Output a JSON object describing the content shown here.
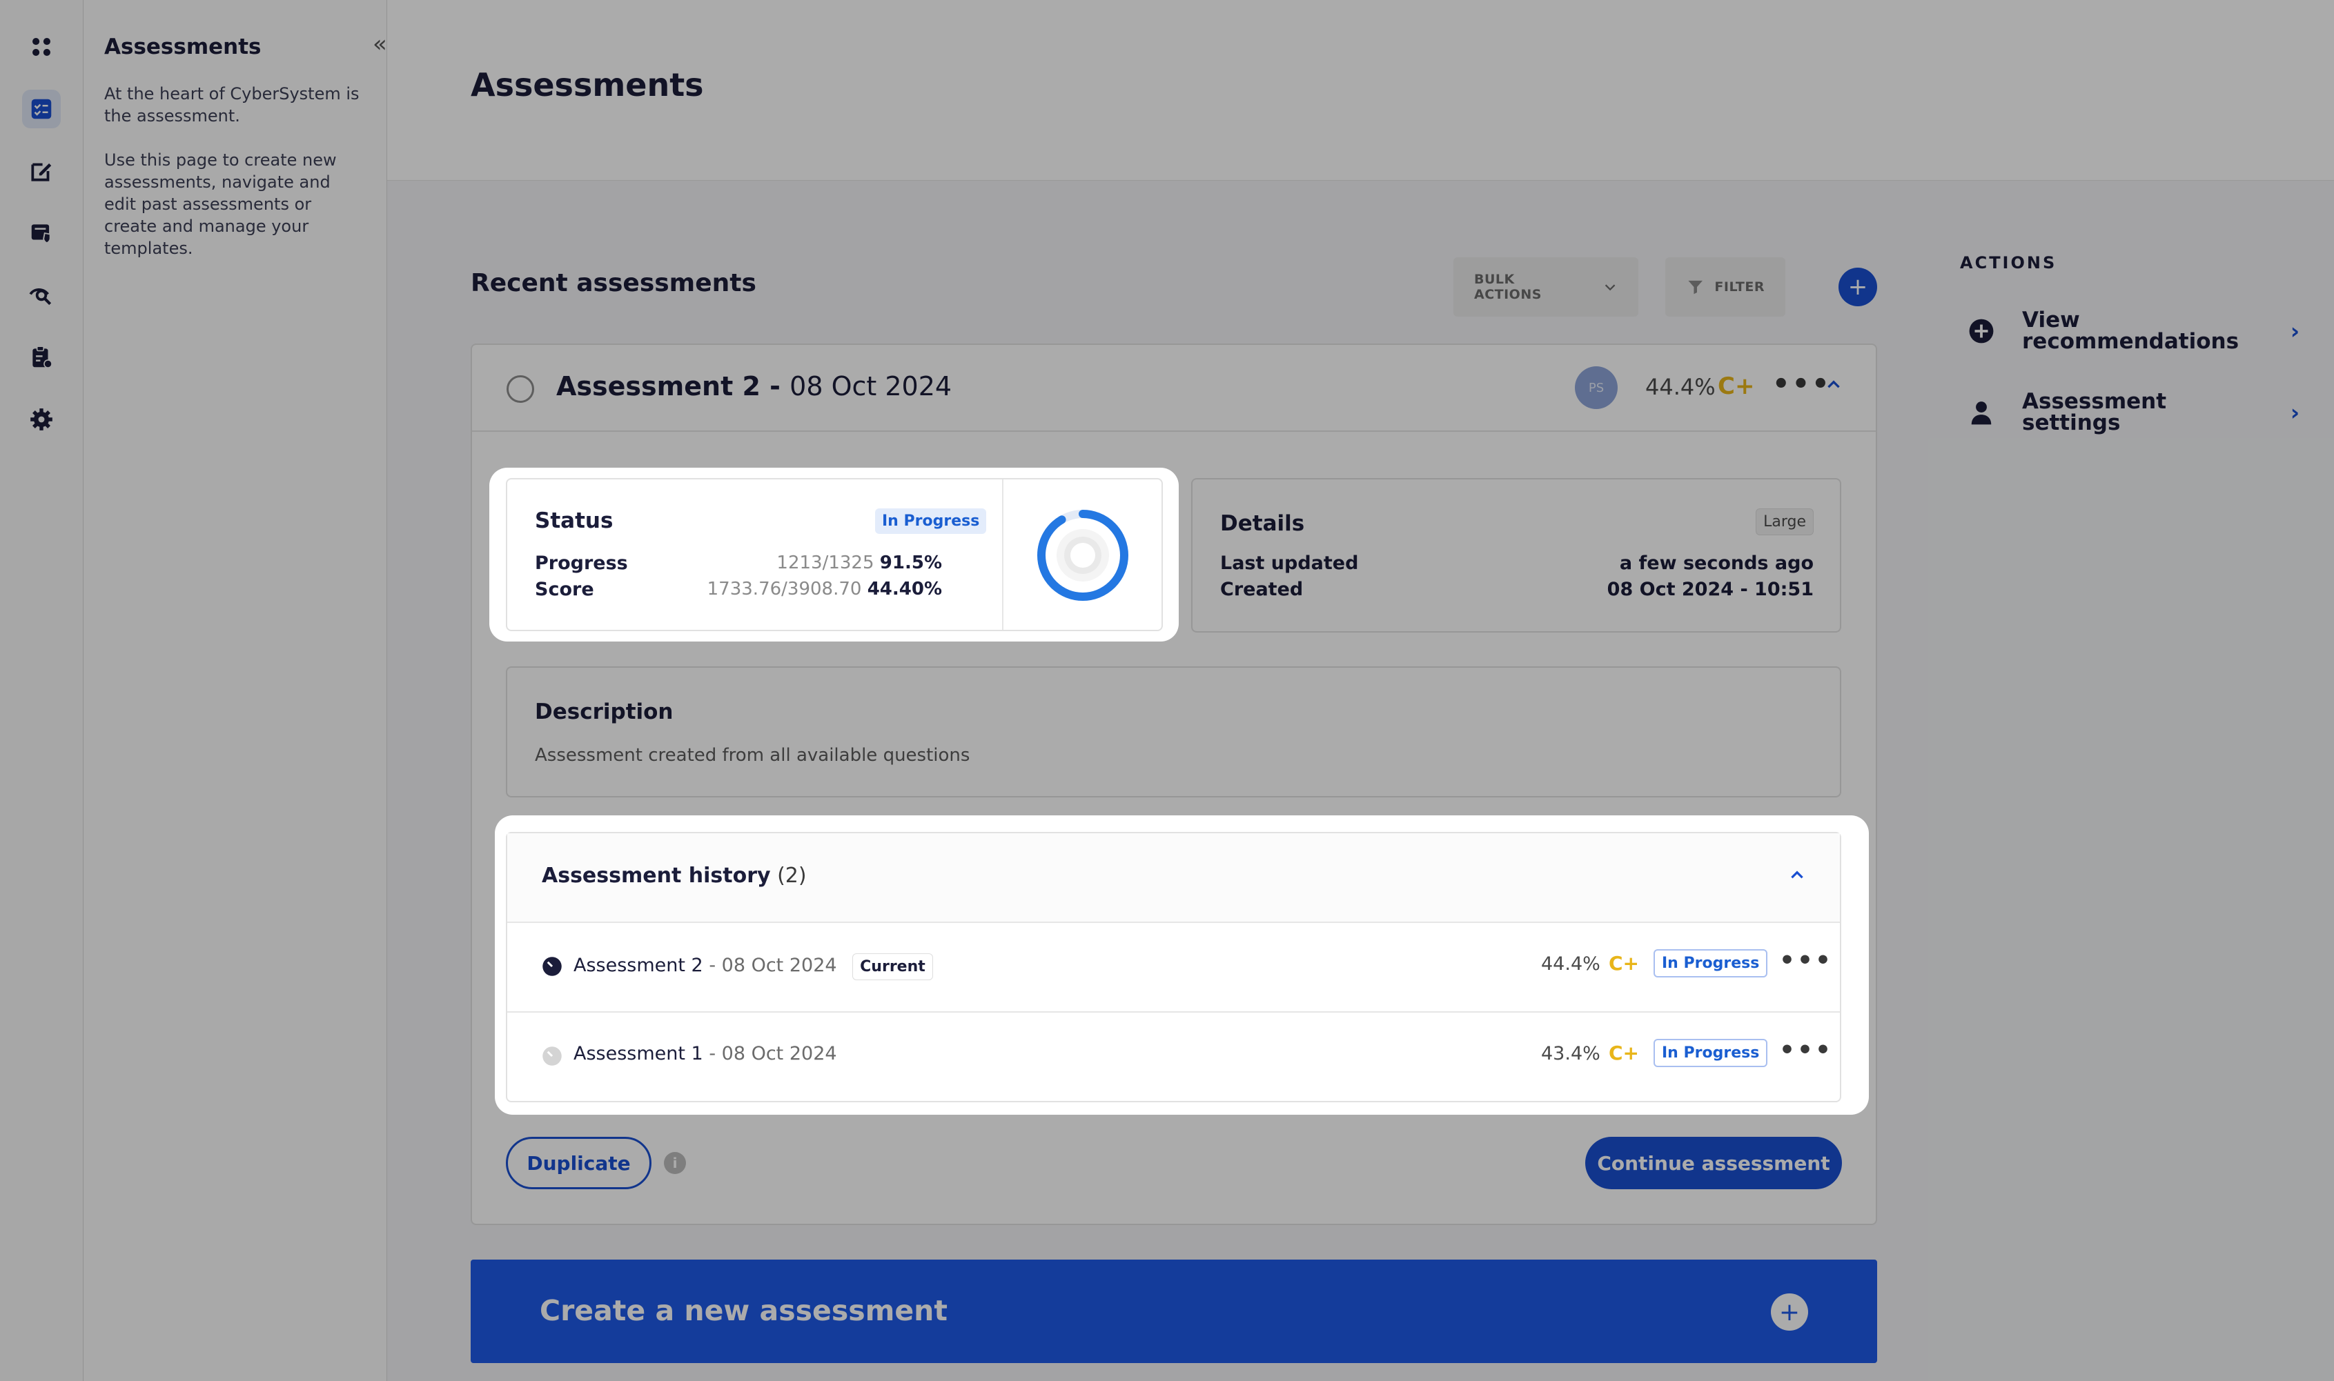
{
  "sidebar": {
    "title": "Assessments",
    "desc1": "At the heart of CyberSystem is the assessment.",
    "desc2": "Use this page to create new assessments, navigate and edit past assessments or create and manage your templates.",
    "collapse_glyph": "«"
  },
  "header": {
    "title": "Assessments"
  },
  "recent": {
    "title": "Recent assessments",
    "bulk_actions": "BULK ACTIONS",
    "filter": "FILTER",
    "add_glyph": "+"
  },
  "assessment": {
    "name": "Assessment 2 - ",
    "date": "08 Oct 2024",
    "avatar": "PS",
    "score": "44.4%",
    "grade": "C+"
  },
  "status": {
    "title": "Status",
    "badge": "In Progress",
    "progress_label": "Progress",
    "progress_fraction": "1213/1325",
    "progress_pct": "91.5%",
    "progress_value": 0.915,
    "score_label": "Score",
    "score_fraction": "1733.76/3908.70",
    "score_pct": "44.40%"
  },
  "details": {
    "title": "Details",
    "size": "Large",
    "last_updated_label": "Last updated",
    "last_updated_value": "a few seconds ago",
    "created_label": "Created",
    "created_value": "08 Oct 2024 - 10:51"
  },
  "description": {
    "title": "Description",
    "text": "Assessment created from all available questions"
  },
  "history": {
    "title": "Assessment history",
    "count": "(2)",
    "rows": [
      {
        "name": "Assessment 2",
        "date": " - 08 Oct 2024",
        "tag": "Current",
        "score": "44.4%",
        "grade": "C+",
        "status": "In Progress"
      },
      {
        "name": "Assessment 1",
        "date": " - 08 Oct 2024",
        "tag": "",
        "score": "43.4%",
        "grade": "C+",
        "status": "In Progress"
      }
    ]
  },
  "buttons": {
    "duplicate": "Duplicate",
    "continue": "Continue assessment",
    "info_glyph": "i"
  },
  "create": {
    "label": "Create a new assessment",
    "plus_glyph": "+"
  },
  "actions": {
    "title": "ACTIONS",
    "items": [
      {
        "label": "View recommendations",
        "icon": "plus-circle-icon"
      },
      {
        "label": "Assessment settings",
        "icon": "user-icon"
      }
    ]
  },
  "colors": {
    "accent": "#1a4fd1",
    "grade": "#e8b51a",
    "badge_text": "#1a5ed1"
  }
}
